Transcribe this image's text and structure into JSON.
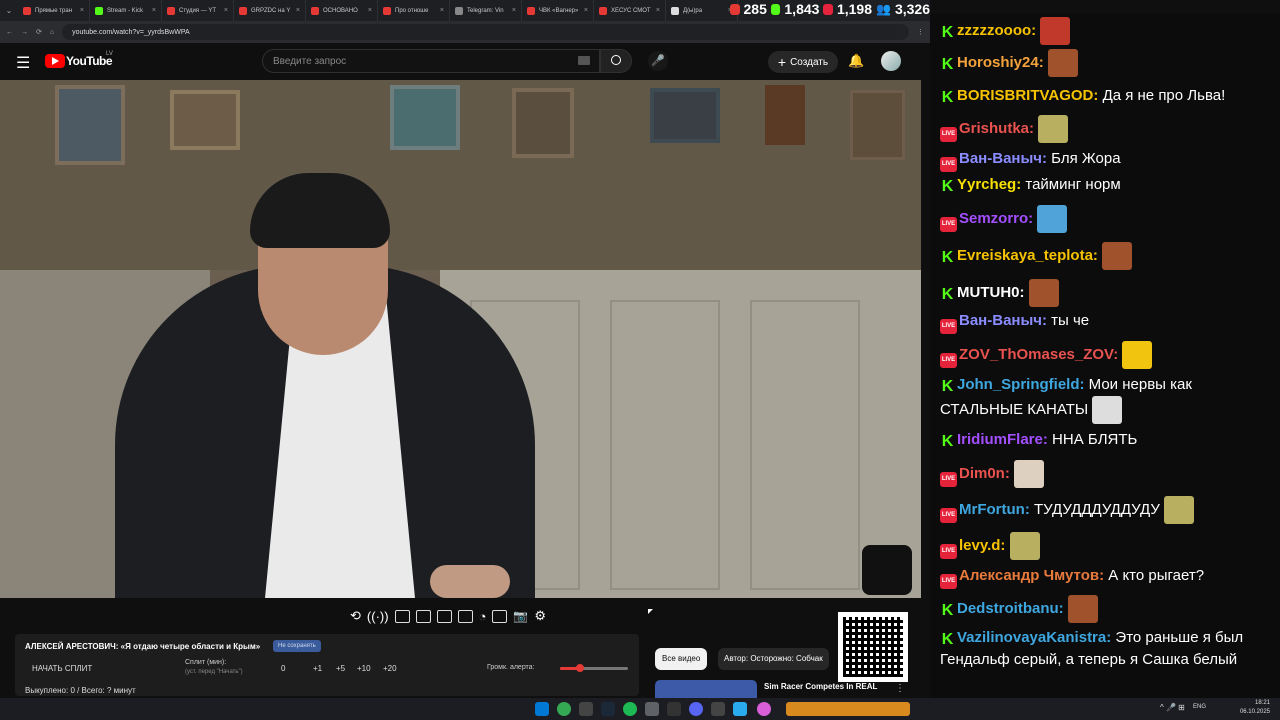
{
  "browser": {
    "tabs": [
      {
        "label": "Прямые тран",
        "color": "#e53935"
      },
      {
        "label": "Stream - Kick",
        "color": "#53fc18"
      },
      {
        "label": "Студия — YT",
        "color": "#e53935"
      },
      {
        "label": "GRPZDC на Y",
        "color": "#e53935"
      },
      {
        "label": "ОСНОВАНО",
        "color": "#e53935"
      },
      {
        "label": "Про отноше",
        "color": "#e53935"
      },
      {
        "label": "Telegram: Vin",
        "color": "#888888"
      },
      {
        "label": "ЧВК «Вагнер»",
        "color": "#e53935"
      },
      {
        "label": "ХЕСУС СМОТ",
        "color": "#e53935"
      },
      {
        "label": "Д(ы)ра",
        "color": "#dddddd"
      }
    ],
    "url": "youtube.com/watch?v=_yyrdsBwWPA"
  },
  "stream_stats": {
    "youtube_viewers": "285",
    "kick_viewers": "1,843",
    "live_viewers": "1,198",
    "total_viewers": "3,326"
  },
  "youtube": {
    "logo": "YouTube",
    "region": "LV",
    "search_placeholder": "Введите запрос",
    "create_label": "Создать"
  },
  "panel": {
    "title": "АЛЕКСЕЙ АРЕСТОВИЧ: «Я отдаю четыре области и Крым»",
    "badge": "Не сохранять",
    "start_split": "НАЧАТЬ СПЛИТ",
    "split_label": "Сплит (мин):",
    "split_hint": "(уст. перед \"Начать\")",
    "split_value": "0",
    "plus_buttons": [
      "+1",
      "+5",
      "+10",
      "+20"
    ],
    "volume_label": "Громк. алерта:",
    "bought": "Выкуплено: 0 / Всего: ? минут"
  },
  "recommendations": {
    "all_videos": "Все видео",
    "author_chip": "Автор: Осторожно: Собчак",
    "video_title": "Sim Racer Competes In REAL"
  },
  "chat": [
    {
      "platform": "kick",
      "user": "zzzzzoooo:",
      "color": "#f7c300",
      "text": "",
      "emote": "#c0392b"
    },
    {
      "platform": "kick",
      "user": "Horoshiy24:",
      "color": "#f4a33c",
      "text": "",
      "emote": "#a0522d"
    },
    {
      "platform": "kick",
      "user": "BORISBRITVAGOD:",
      "color": "#f7c300",
      "text": "Да я не про Льва!",
      "emote": ""
    },
    {
      "platform": "live",
      "user": "Grishutka:",
      "color": "#e8524f",
      "text": "",
      "emote": "#b8b060"
    },
    {
      "platform": "live",
      "user": "Ван-Ваныч:",
      "color": "#8a8cff",
      "text": "Бля Жора",
      "emote": ""
    },
    {
      "platform": "kick",
      "user": "Yyrcheg:",
      "color": "#f7e000",
      "text": "тайминг норм",
      "emote": ""
    },
    {
      "platform": "live",
      "user": "Semzorro:",
      "color": "#a44fff",
      "text": "",
      "emote": "#4fa3d9"
    },
    {
      "platform": "kick",
      "user": "Evreiskaya_teplota:",
      "color": "#f7c300",
      "text": "",
      "emote": "#a0522d"
    },
    {
      "platform": "kick",
      "user": "MUTUH0:",
      "color": "#ffffff",
      "text": "",
      "emote": "#a0522d"
    },
    {
      "platform": "live",
      "user": "Ван-Ваныч:",
      "color": "#8a8cff",
      "text": "ты че",
      "emote": ""
    },
    {
      "platform": "live",
      "user": "ZOV_ThOmases_ZOV:",
      "color": "#e8524f",
      "text": "",
      "emote": "#f1c40f"
    },
    {
      "platform": "kick",
      "user": "John_Springfield:",
      "color": "#3fa7e0",
      "text": "Мои нервы как СТАЛЬНЫЕ КАНАТЫ",
      "emote": "#dddddd"
    },
    {
      "platform": "kick",
      "user": "IridiumFlare:",
      "color": "#a44fff",
      "text": "ННА БЛЯТЬ",
      "emote": ""
    },
    {
      "platform": "live",
      "user": "Dim0n:",
      "color": "#e8524f",
      "text": "",
      "emote": "#ddd0c0"
    },
    {
      "platform": "live",
      "user": "MrFortun:",
      "color": "#3fa7e0",
      "text": "ТУДУДДДУДДУДУ",
      "emote": "#b8b060"
    },
    {
      "platform": "live",
      "user": "levy.d:",
      "color": "#f7c300",
      "text": "",
      "emote": "#b8b060"
    },
    {
      "platform": "live",
      "user": "Александр Чмутов:",
      "color": "#e87a3c",
      "text": "А кто рыгает?",
      "emote": ""
    },
    {
      "platform": "kick",
      "user": "Dedstroitbanu:",
      "color": "#3fa7e0",
      "text": "",
      "emote": "#a0522d"
    },
    {
      "platform": "kick",
      "user": "VazilinovayaKanistra:",
      "color": "#3fa7e0",
      "text": "Это раньше я был Гендальф серый, а теперь я Сашка белый",
      "emote": ""
    }
  ],
  "taskbar": {
    "lang": "ENG",
    "time": "18:21",
    "date": "06.10.2025"
  }
}
